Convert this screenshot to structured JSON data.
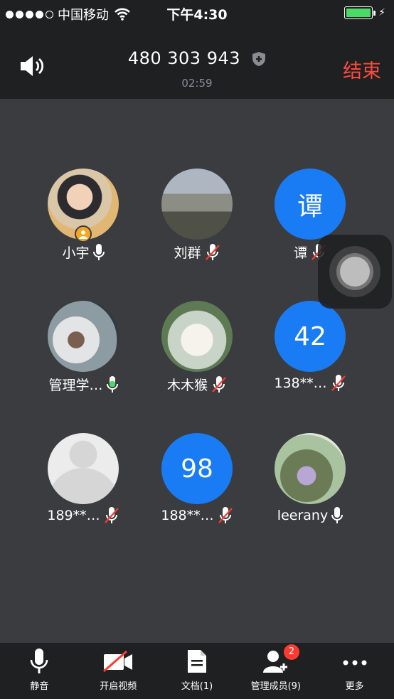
{
  "status_bar": {
    "carrier": "中国移动",
    "time": "下午4:30",
    "signal_icon": "signal-dots-icon",
    "wifi_icon": "wifi-icon",
    "battery_icon": "battery-icon",
    "battery_color": "#4cd964"
  },
  "header": {
    "meeting_id": "480 303 943",
    "duration": "02:59",
    "end_label": "结束",
    "end_color": "#ff4b3e"
  },
  "participants": [
    {
      "name": "小宇",
      "avatar": "photo",
      "mic": "on",
      "host": true
    },
    {
      "name": "刘群",
      "avatar": "photo",
      "mic": "muted"
    },
    {
      "name": "谭",
      "avatar_text": "谭",
      "mic": "muted"
    },
    {
      "name": "管理学…",
      "avatar": "photo",
      "mic": "speaking"
    },
    {
      "name": "木木猴",
      "avatar": "photo",
      "mic": "muted"
    },
    {
      "name": "138**…",
      "avatar_text": "42",
      "mic": "muted"
    },
    {
      "name": "189**…",
      "avatar": "default",
      "mic": "muted"
    },
    {
      "name": "188**…",
      "avatar_text": "98",
      "mic": "muted"
    },
    {
      "name": "leerany",
      "avatar": "photo",
      "mic": "on"
    }
  ],
  "toolbar": {
    "mute_label": "静音",
    "video_label": "开启视频",
    "docs_label": "文档(1)",
    "members_label": "管理成员(9)",
    "members_badge": "2",
    "more_label": "更多"
  }
}
